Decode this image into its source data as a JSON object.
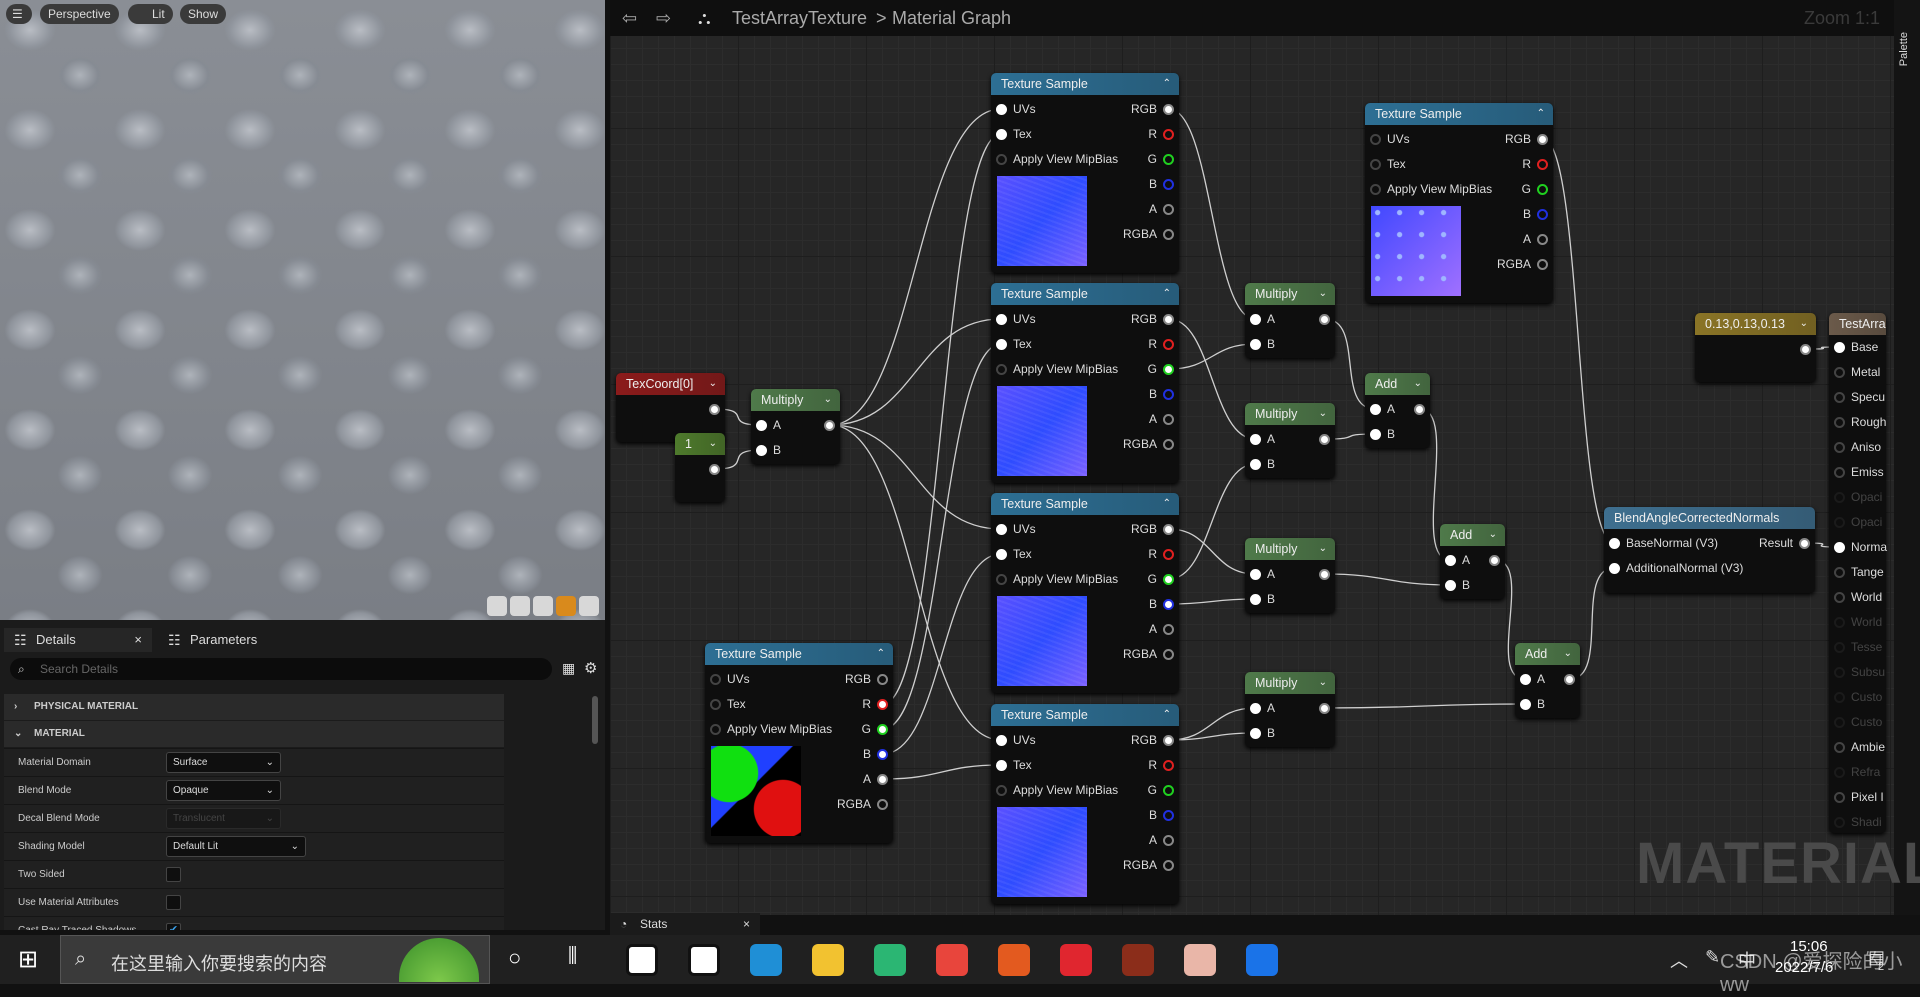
{
  "viewport": {
    "menu_icon": "hamburger-icon",
    "view_mode": "Perspective",
    "lighting": "Lit",
    "show": "Show"
  },
  "details": {
    "tabs": [
      {
        "label": "Details",
        "close": "×"
      },
      {
        "label": "Parameters"
      }
    ],
    "search_placeholder": "Search Details",
    "sections": [
      {
        "label": "PHYSICAL MATERIAL",
        "expanded": false
      },
      {
        "label": "MATERIAL",
        "expanded": true
      }
    ],
    "rows": [
      {
        "label": "Material Domain",
        "type": "dropdown",
        "value": "Surface"
      },
      {
        "label": "Blend Mode",
        "type": "dropdown",
        "value": "Opaque"
      },
      {
        "label": "Decal Blend Mode",
        "type": "dropdown",
        "value": "Translucent",
        "disabled": true
      },
      {
        "label": "Shading Model",
        "type": "dropdown",
        "value": "Default Lit"
      },
      {
        "label": "Two Sided",
        "type": "checkbox",
        "checked": false
      },
      {
        "label": "Use Material Attributes",
        "type": "checkbox",
        "checked": false
      },
      {
        "label": "Cast Ray Traced Shadows",
        "type": "checkbox",
        "checked": true
      }
    ]
  },
  "graph": {
    "breadcrumb": {
      "asset": "TestArrayTexture",
      "separator": ">",
      "graph": "Material Graph"
    },
    "zoom": "Zoom 1:1",
    "palette": "Palette",
    "watermark": "MATERIAL",
    "colors": {
      "texture_header": "#2d6f94",
      "math_header": "#4f7a4a",
      "texcoord_header": "#8b1b1b",
      "constant_header": "#4e7a2c",
      "vector_header": "#8a7426",
      "function_header": "#3e6f8f",
      "result_header": "#6b5a4a"
    },
    "nodes": [
      {
        "id": "ts1",
        "title": "Texture Sample",
        "kind": "texture",
        "inputs": [
          "UVs",
          "Tex",
          "Apply View MipBias"
        ],
        "outputs": [
          "RGB",
          "R",
          "G",
          "B",
          "A",
          "RGBA"
        ]
      },
      {
        "id": "ts2",
        "title": "Texture Sample",
        "kind": "texture",
        "inputs": [
          "UVs",
          "Tex",
          "Apply View MipBias"
        ],
        "outputs": [
          "RGB",
          "R",
          "G",
          "B",
          "A",
          "RGBA"
        ]
      },
      {
        "id": "ts3",
        "title": "Texture Sample",
        "kind": "texture",
        "inputs": [
          "UVs",
          "Tex",
          "Apply View MipBias"
        ],
        "outputs": [
          "RGB",
          "R",
          "G",
          "B",
          "A",
          "RGBA"
        ]
      },
      {
        "id": "ts4",
        "title": "Texture Sample",
        "kind": "texture",
        "inputs": [
          "UVs",
          "Tex",
          "Apply View MipBias"
        ],
        "outputs": [
          "RGB",
          "R",
          "G",
          "B",
          "A",
          "RGBA"
        ]
      },
      {
        "id": "ts5",
        "title": "Texture Sample",
        "kind": "texture",
        "inputs": [
          "UVs",
          "Tex",
          "Apply View MipBias"
        ],
        "outputs": [
          "RGB",
          "R",
          "G",
          "B",
          "A",
          "RGBA"
        ]
      },
      {
        "id": "ts6",
        "title": "Texture Sample",
        "kind": "texture",
        "inputs": [
          "UVs",
          "Tex",
          "Apply View MipBias"
        ],
        "outputs": [
          "RGB",
          "R",
          "G",
          "B",
          "A",
          "RGBA"
        ]
      },
      {
        "id": "texcoord",
        "title": "TexCoord[0]",
        "kind": "texcoord",
        "inputs": [],
        "outputs": [
          ""
        ]
      },
      {
        "id": "c1",
        "title": "1",
        "kind": "constant",
        "inputs": [],
        "outputs": [
          ""
        ]
      },
      {
        "id": "mul0",
        "title": "Multiply",
        "kind": "math",
        "inputs": [
          "A",
          "B"
        ],
        "outputs": [
          ""
        ]
      },
      {
        "id": "mul1",
        "title": "Multiply",
        "kind": "math",
        "inputs": [
          "A",
          "B"
        ],
        "outputs": [
          ""
        ]
      },
      {
        "id": "mul2",
        "title": "Multiply",
        "kind": "math",
        "inputs": [
          "A",
          "B"
        ],
        "outputs": [
          ""
        ]
      },
      {
        "id": "mul3",
        "title": "Multiply",
        "kind": "math",
        "inputs": [
          "A",
          "B"
        ],
        "outputs": [
          ""
        ]
      },
      {
        "id": "mul4",
        "title": "Multiply",
        "kind": "math",
        "inputs": [
          "A",
          "B"
        ],
        "outputs": [
          ""
        ]
      },
      {
        "id": "add1",
        "title": "Add",
        "kind": "math",
        "inputs": [
          "A",
          "B"
        ],
        "outputs": [
          ""
        ]
      },
      {
        "id": "add2",
        "title": "Add",
        "kind": "math",
        "inputs": [
          "A",
          "B"
        ],
        "outputs": [
          ""
        ]
      },
      {
        "id": "add3",
        "title": "Add",
        "kind": "math",
        "inputs": [
          "A",
          "B"
        ],
        "outputs": [
          ""
        ]
      },
      {
        "id": "c3",
        "title": "0.13,0.13,0.13",
        "kind": "vector",
        "inputs": [],
        "outputs": [
          ""
        ]
      },
      {
        "id": "blend",
        "title": "BlendAngleCorrectedNormals",
        "kind": "function",
        "inputs": [
          "BaseNormal (V3)",
          "AdditionalNormal (V3)"
        ],
        "outputs": [
          "Result"
        ]
      },
      {
        "id": "result",
        "title": "TestArra",
        "kind": "result",
        "inputs": [
          "Base",
          "Metal",
          "Specu",
          "Rough",
          "Aniso",
          "Emiss",
          "Opaci",
          "Opaci",
          "Norma",
          "Tange",
          "World",
          "World",
          "Tesse",
          "Subsu",
          "Custo",
          "Custo",
          "Ambie",
          "Refra",
          "Pixel I",
          "Shadi"
        ],
        "disabled_inputs": [
          6,
          7,
          11,
          12,
          13,
          14,
          15,
          17,
          19
        ],
        "outputs": []
      }
    ]
  },
  "stats_tab": {
    "label": "Stats",
    "close": "×"
  },
  "taskbar": {
    "search_placeholder": "在这里输入你要搜索的内容",
    "time": "15:06",
    "date": "2022/7/6",
    "ime": "中",
    "notifications": "2",
    "watermark": "CSDN @爱探险的小ww",
    "apps": [
      "terminal",
      "typora",
      "edge",
      "file-explorer",
      "app-green",
      "chrome",
      "origin",
      "netease-music",
      "game",
      "avatar-app",
      "app-blue"
    ]
  }
}
